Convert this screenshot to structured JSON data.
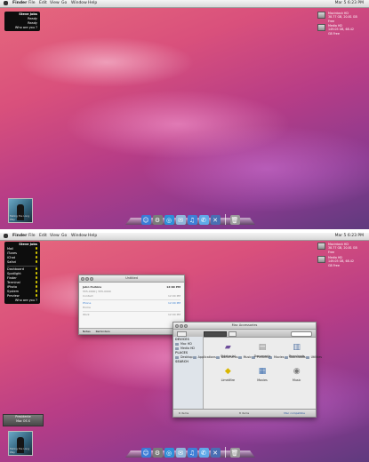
{
  "menubar": {
    "app": "Finder",
    "items": [
      "File",
      "Edit",
      "View",
      "Go",
      "Window",
      "Help"
    ],
    "clock": "Mar 5 6:23 PM"
  },
  "widget_small": {
    "title": "Steve Jobs",
    "rows": [
      {
        "label": "Mail",
        "value": "Ready"
      },
      {
        "label": "Safari",
        "value": "Ready"
      }
    ],
    "footer": "Who are you ?"
  },
  "widget_large": {
    "title": "Steve Jobs",
    "rows": [
      {
        "label": "Mail",
        "on": true
      },
      {
        "label": "iTunes",
        "on": true
      },
      {
        "label": "iChat",
        "on": true
      },
      {
        "label": "Safari",
        "on": true
      }
    ],
    "rows2": [
      {
        "label": "Dashboard",
        "on": true
      },
      {
        "label": "Spotlight",
        "on": true
      },
      {
        "label": "Finder",
        "on": true
      },
      {
        "label": "Terminal",
        "on": true
      },
      {
        "label": "iPhoto",
        "on": true
      },
      {
        "label": "System",
        "on": true
      },
      {
        "label": "Preview",
        "on": true
      }
    ],
    "footer": "Who are you ?"
  },
  "disks": [
    {
      "name": "Macintosh HD",
      "detail": "38.77 GB, 20.81 GB Free"
    },
    {
      "name": "Media HD",
      "detail": "149.05 GB, 68.42 GB Free"
    }
  ],
  "album": {
    "caption": "Taking the Long Way"
  },
  "dock": {
    "icons": [
      {
        "name": "finder-icon",
        "glyph": "☺",
        "color": "#3a7bd5"
      },
      {
        "name": "system-prefs-icon",
        "glyph": "⚙",
        "color": "#7a7a7a"
      },
      {
        "name": "safari-icon",
        "glyph": "◎",
        "color": "#2f8ed8"
      },
      {
        "name": "mail-icon",
        "glyph": "✉",
        "color": "#8fb5d9"
      },
      {
        "name": "itunes-icon",
        "glyph": "♫",
        "color": "#3f7fd6"
      },
      {
        "name": "ichat-icon",
        "glyph": "✆",
        "color": "#5fa9e8"
      },
      {
        "name": "xcode-icon",
        "glyph": "✕",
        "color": "#4a6fb3"
      }
    ],
    "trash": {
      "name": "trash-icon",
      "glyph": "🗑",
      "color": "#9a9a9a"
    }
  },
  "notes_window": {
    "title": "Untitled",
    "rows": [
      {
        "left": "John Perkins",
        "right": "12:00 PM",
        "highlight": false
      },
      {
        "left": "555-0000 | 555-0000",
        "right": "",
        "highlight": false
      },
      {
        "left": "Contact",
        "right": "12:00 PM",
        "highlight": false
      },
      {
        "left": "Phone",
        "right": "12:00 PM",
        "highlight": true
      },
      {
        "left": "Home",
        "right": "",
        "highlight": false
      },
      {
        "left": "Work",
        "right": "12:00 PM",
        "highlight": false
      }
    ],
    "bottom": [
      "Notes",
      "Reminders"
    ]
  },
  "finder_window": {
    "title": "Mac Accessories",
    "sidebar_devices_header": "DEVICES",
    "sidebar": {
      "devices": [
        "Mac HD",
        "Media HD"
      ],
      "places_header": "PLACES",
      "places": [
        "Desktop",
        "Applications",
        "Documents",
        "Music",
        "Pictures",
        "Movies",
        "Downloads",
        "Utilities"
      ],
      "search_header": "SEARCH"
    },
    "items": [
      {
        "label": "Sidebarial",
        "icon": "drive-icon",
        "glyph": "▰",
        "color": "#6d4d9a"
      },
      {
        "label": "Documents",
        "icon": "documents-icon",
        "glyph": "▤",
        "color": "#888"
      },
      {
        "label": "Downloads",
        "icon": "downloads-icon",
        "glyph": "▥",
        "color": "#5a7aa8"
      },
      {
        "label": "LimeWire",
        "icon": "limewire-icon",
        "glyph": "◆",
        "color": "#d9b600"
      },
      {
        "label": "Movies",
        "icon": "movies-icon",
        "glyph": "▦",
        "color": "#3e6fb0"
      },
      {
        "label": "Music",
        "icon": "music-icon",
        "glyph": "◉",
        "color": "#777"
      }
    ],
    "status_left": "6 items",
    "status_mid": "8 items",
    "status_right": "Mac compatible"
  },
  "login_box": {
    "line1": "Presidente",
    "line2": "Mac OS X"
  }
}
